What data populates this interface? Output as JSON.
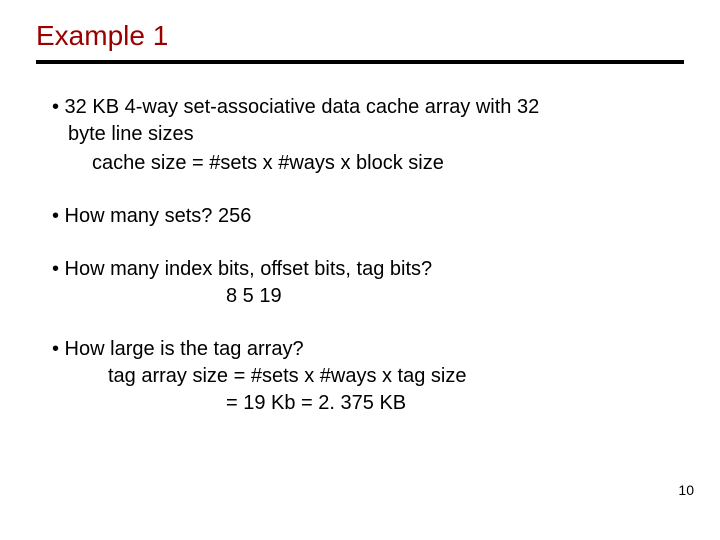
{
  "title": "Example 1",
  "bullets": {
    "b1": {
      "line1": "• 32 KB 4-way set-associative data cache array with 32",
      "line2": "byte line sizes"
    },
    "formula": "cache size = #sets x #ways x block size",
    "b2": "• How many sets?   256",
    "b3": {
      "line1": "• How many index bits, offset bits, tag bits?",
      "line2": "8              5             19"
    },
    "b4": {
      "line1": "• How large is the tag array?",
      "line2": "tag array size = #sets x #ways x tag size",
      "line3": "= 19 Kb = 2. 375 KB"
    }
  },
  "page_number": "10"
}
